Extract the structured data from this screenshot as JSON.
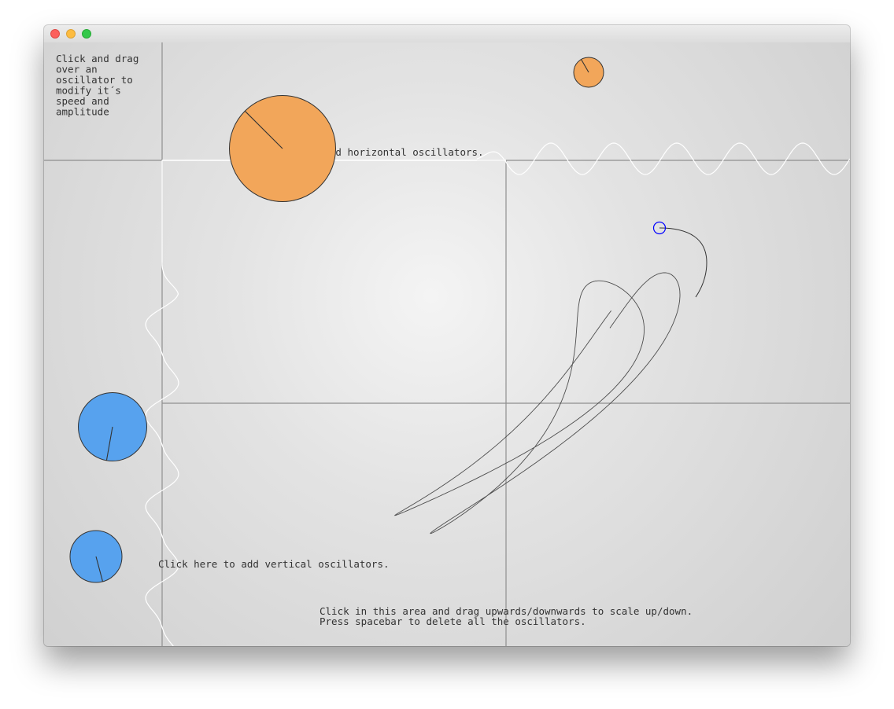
{
  "window": {
    "traffic_lights": {
      "close_color": "#fc605c",
      "minimize_color": "#fdbc40",
      "zoom_color": "#34c84a"
    }
  },
  "instructions": {
    "drag_lines": [
      "Click and drag",
      "over an",
      "oscillator to",
      "modify it´s",
      "speed and",
      "amplitude"
    ],
    "add_horizontal": "Click here to add horizontal oscillators.",
    "add_vertical": "Click here to add vertical oscillators.",
    "scale_line": "Click in this area and drag upwards/downwards to scale up/down.",
    "delete_line": "Press spacebar to delete all the oscillators."
  },
  "colors": {
    "horizontal_oscillator": "#f2a65a",
    "vertical_oscillator": "#57a2ee",
    "trace": "#333333",
    "wave": "#ffffff",
    "cursor": "#0000ff",
    "grid": "#8f8f8f"
  },
  "oscillators": {
    "horizontal": [
      {
        "name": "horizontal-oscillator-1",
        "needle_angle_deg": 225
      },
      {
        "name": "horizontal-oscillator-2",
        "needle_angle_deg": 240
      }
    ],
    "vertical": [
      {
        "name": "vertical-oscillator-1",
        "needle_angle_deg": 100
      },
      {
        "name": "vertical-oscillator-2",
        "needle_angle_deg": 75
      }
    ]
  }
}
